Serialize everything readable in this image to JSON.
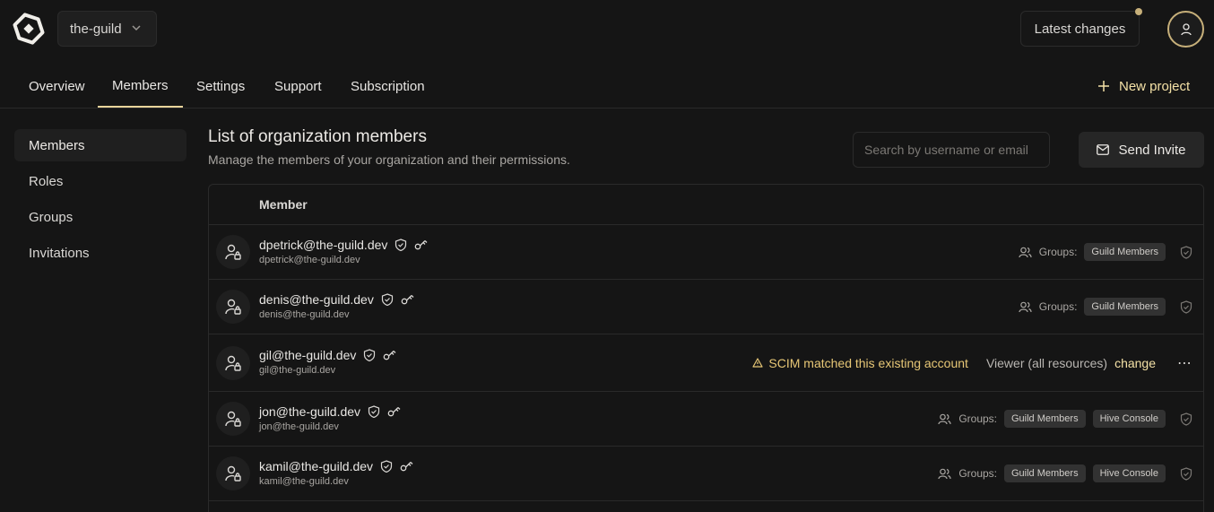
{
  "header": {
    "org_name": "the-guild",
    "latest_changes_label": "Latest changes"
  },
  "tabs": [
    {
      "label": "Overview"
    },
    {
      "label": "Members",
      "active": true
    },
    {
      "label": "Settings"
    },
    {
      "label": "Support"
    },
    {
      "label": "Subscription"
    }
  ],
  "new_project_label": "New project",
  "sidebar": {
    "items": [
      {
        "label": "Members",
        "active": true
      },
      {
        "label": "Roles"
      },
      {
        "label": "Groups"
      },
      {
        "label": "Invitations"
      }
    ]
  },
  "main": {
    "title": "List of organization members",
    "description": "Manage the members of your organization and their permissions.",
    "search_placeholder": "Search by username or email",
    "send_invite_label": "Send Invite",
    "table_header": "Member"
  },
  "members": [
    {
      "name": "dpetrick@the-guild.dev",
      "email": "dpetrick@the-guild.dev",
      "groups_label": "Groups:",
      "groups": [
        "Guild Members"
      ]
    },
    {
      "name": "denis@the-guild.dev",
      "email": "denis@the-guild.dev",
      "groups_label": "Groups:",
      "groups": [
        "Guild Members"
      ]
    },
    {
      "name": "gil@the-guild.dev",
      "email": "gil@the-guild.dev",
      "scim_notice": "SCIM matched this existing account",
      "role": "Viewer (all resources)",
      "change_label": "change"
    },
    {
      "name": "jon@the-guild.dev",
      "email": "jon@the-guild.dev",
      "groups_label": "Groups:",
      "groups": [
        "Guild Members",
        "Hive Console"
      ]
    },
    {
      "name": "kamil@the-guild.dev",
      "email": "kamil@the-guild.dev",
      "groups_label": "Groups:",
      "groups": [
        "Guild Members",
        "Hive Console"
      ]
    }
  ],
  "colors": {
    "background": "#151515",
    "accent": "#f4e1a6",
    "warning": "#e7c776",
    "border": "#2a2a2a"
  }
}
